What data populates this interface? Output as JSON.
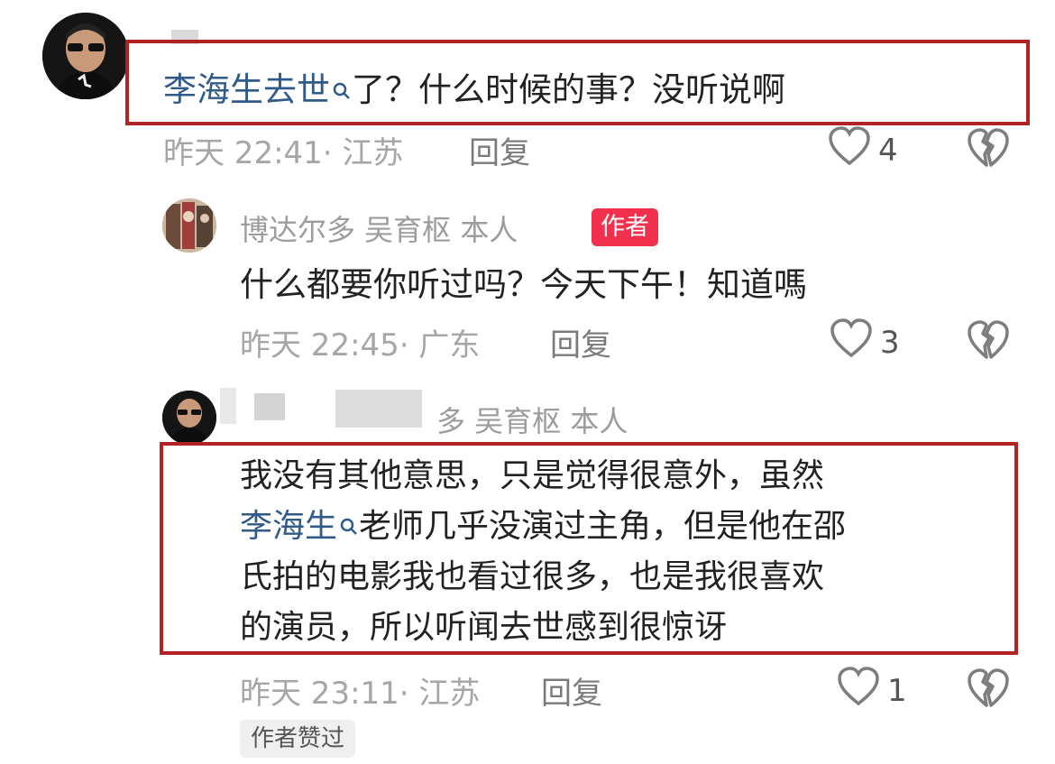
{
  "comments": [
    {
      "text_prefix_link": "李海生去世",
      "text_suffix": "了？什么时候的事？没听说啊",
      "time_location": "昨天 22:41· 江苏",
      "reply_label": "回复",
      "likes": "4"
    },
    {
      "author": "博达尔多 吴育枢 本人",
      "author_badge": "作者",
      "text": "什么都要你听过吗？今天下午！知道嗎",
      "time_location": "昨天 22:45· 广东",
      "reply_label": "回复",
      "likes": "3"
    },
    {
      "author_partial": "多 吴育枢 本人",
      "line1": "我没有其他意思，只是觉得很意外，虽然",
      "line2_link": "李海生",
      "line2_rest": "老师几乎没演过主角，但是他在邵",
      "line3": "氏拍的电影我也看过很多，也是我很喜欢",
      "line4": "的演员，所以听闻去世感到很惊讶",
      "time_location": "昨天 23:11· 江苏",
      "reply_label": "回复",
      "likes": "1",
      "liked_by_author": "作者赞过"
    }
  ],
  "colors": {
    "highlight_box": "#b22222",
    "link": "#2f5a8a",
    "author_badge": "#f0304c"
  }
}
